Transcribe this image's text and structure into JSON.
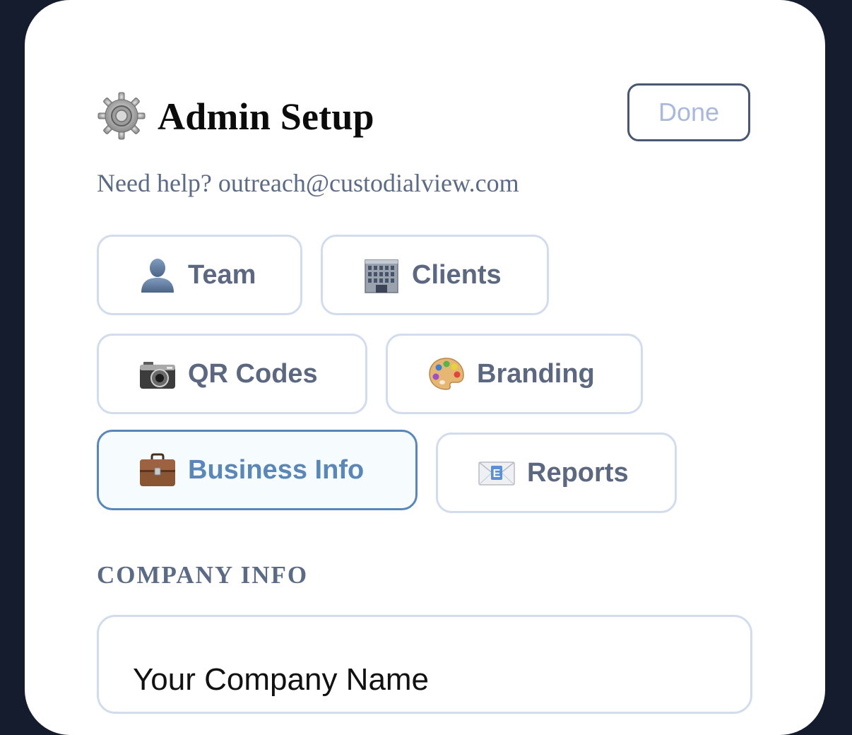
{
  "header": {
    "title": "Admin Setup",
    "done_label": "Done",
    "icon": "gear-icon"
  },
  "help_text": "Need help? outreach@custodialview.com",
  "tabs": [
    {
      "label": "Team",
      "icon": "person-silhouette-icon",
      "active": false
    },
    {
      "label": "Clients",
      "icon": "office-building-icon",
      "active": false
    },
    {
      "label": "QR Codes",
      "icon": "camera-icon",
      "active": false
    },
    {
      "label": "Branding",
      "icon": "artist-palette-icon",
      "active": false
    },
    {
      "label": "Business Info",
      "icon": "briefcase-icon",
      "active": true
    },
    {
      "label": "Reports",
      "icon": "email-envelope-icon",
      "active": false
    }
  ],
  "section": {
    "label": "COMPANY INFO"
  },
  "company_name_field": {
    "placeholder": "Your Company Name",
    "value": ""
  },
  "colors": {
    "backdrop": "#141c2e",
    "card": "#ffffff",
    "accent": "#5a87b8",
    "muted_text": "#5c6b85",
    "tab_border": "#d2dced"
  }
}
